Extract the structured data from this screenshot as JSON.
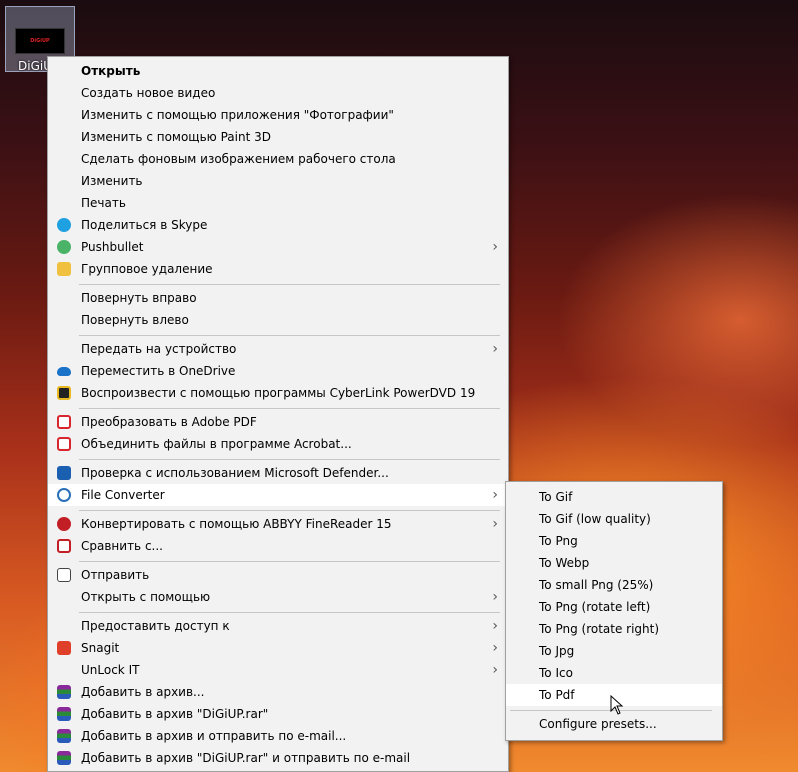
{
  "desktop": {
    "icon_label": "DiGiUP",
    "thumb_text": "DiGiUP"
  },
  "menu": {
    "items": [
      {
        "label": "Открыть",
        "icon": "none",
        "bold": true
      },
      {
        "label": "Создать новое видео",
        "icon": "none"
      },
      {
        "label": "Изменить с помощью приложения \"Фотографии\"",
        "icon": "none"
      },
      {
        "label": "Изменить с помощью Paint 3D",
        "icon": "none"
      },
      {
        "label": "Сделать фоновым изображением рабочего стола",
        "icon": "none"
      },
      {
        "label": "Изменить",
        "icon": "none"
      },
      {
        "label": "Печать",
        "icon": "none"
      },
      {
        "label": "Поделиться в Skype",
        "icon": "skype-icon",
        "color": "#1fa0e0"
      },
      {
        "label": "Pushbullet",
        "icon": "pushbullet-icon",
        "color": "#4ab367",
        "submenu": true
      },
      {
        "label": "Групповое удаление",
        "icon": "group-delete-icon",
        "color": "#f0c040"
      },
      {
        "label": "Повернуть вправо",
        "icon": "none"
      },
      {
        "label": "Повернуть влево",
        "icon": "none"
      },
      {
        "label": "Передать на устройство",
        "icon": "none",
        "submenu": true
      },
      {
        "label": "Переместить в OneDrive",
        "icon": "onedrive-icon",
        "color": "#1a73c8"
      },
      {
        "label": "Воспроизвести с помощью программы CyberLink PowerDVD 19",
        "icon": "powerdvd-icon",
        "color": "#222222"
      },
      {
        "label": "Преобразовать в Adobe PDF",
        "icon": "adobe-pdf-icon",
        "color": "#d8262e"
      },
      {
        "label": "Объединить файлы в программе Acrobat...",
        "icon": "acrobat-combine-icon",
        "color": "#d8262e"
      },
      {
        "label": "Проверка с использованием Microsoft Defender...",
        "icon": "defender-icon",
        "color": "#1a5fb0"
      },
      {
        "label": "File Converter",
        "icon": "file-converter-icon",
        "color": "#2a6fb8",
        "submenu": true
      },
      {
        "label": "Конвертировать с помощью ABBYY FineReader 15",
        "icon": "abbyy-icon",
        "color": "#c21e25",
        "submenu": true
      },
      {
        "label": "Сравнить с...",
        "icon": "compare-icon",
        "color": "#c21e25"
      },
      {
        "label": "Отправить",
        "icon": "share-icon",
        "color": "#444444"
      },
      {
        "label": "Открыть с помощью",
        "icon": "none",
        "submenu": true
      },
      {
        "label": "Предоставить доступ к",
        "icon": "none",
        "submenu": true
      },
      {
        "label": "Snagit",
        "icon": "snagit-icon",
        "color": "#e0402a",
        "submenu": true
      },
      {
        "label": "UnLock IT",
        "icon": "none",
        "submenu": true
      },
      {
        "label": "Добавить в архив...",
        "icon": "winrar-icon",
        "color": "#8a2a9a"
      },
      {
        "label": "Добавить в архив \"DiGiUP.rar\"",
        "icon": "winrar-icon",
        "color": "#8a2a9a"
      },
      {
        "label": "Добавить в архив и отправить по e-mail...",
        "icon": "winrar-icon",
        "color": "#8a2a9a"
      },
      {
        "label": "Добавить в архив \"DiGiUP.rar\" и отправить по e-mail",
        "icon": "winrar-icon",
        "color": "#8a2a9a"
      }
    ]
  },
  "submenu": {
    "items": [
      {
        "label": "To Gif"
      },
      {
        "label": "To Gif (low quality)"
      },
      {
        "label": "To Png"
      },
      {
        "label": "To Webp"
      },
      {
        "label": "To small Png (25%)"
      },
      {
        "label": "To Png (rotate left)"
      },
      {
        "label": "To Png (rotate right)"
      },
      {
        "label": "To Jpg"
      },
      {
        "label": "To Ico"
      },
      {
        "label": "To Pdf"
      },
      {
        "label": "Configure presets..."
      }
    ]
  }
}
